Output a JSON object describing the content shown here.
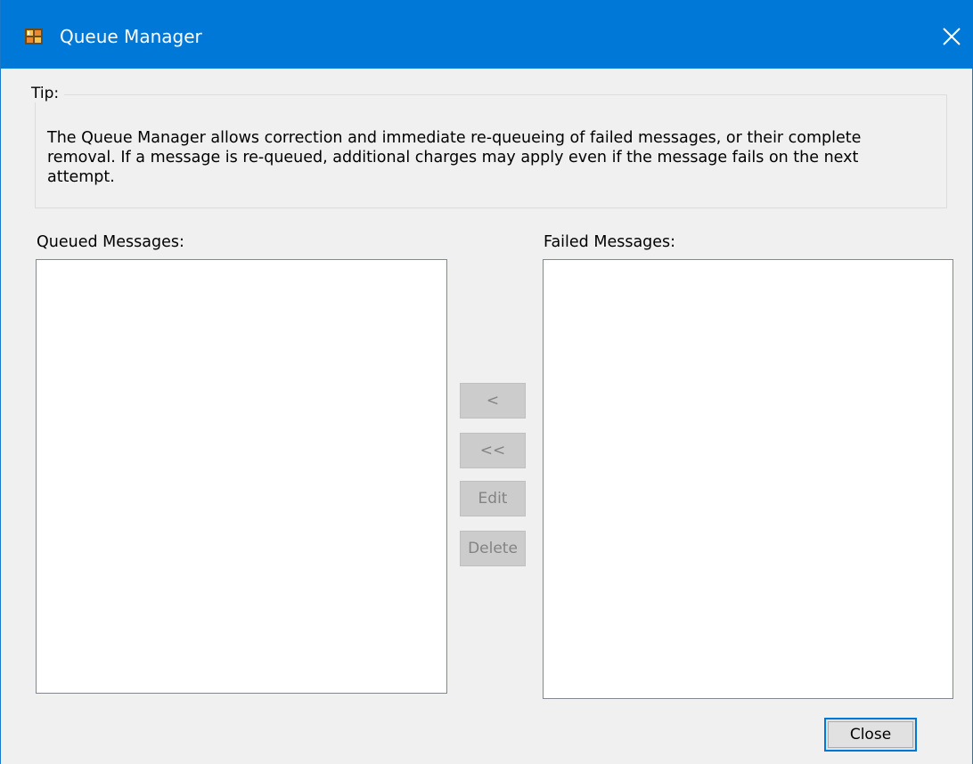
{
  "window": {
    "title": "Queue Manager",
    "accent": "#0078d7",
    "app_icon": "queue-manager-app-icon",
    "close_icon": "close-icon"
  },
  "tip": {
    "label": "Tip:",
    "text": "The Queue Manager allows correction and immediate re-queueing of failed messages, or their complete removal.  If a message is re-queued, additional charges may apply even if the message fails on the next attempt."
  },
  "queued": {
    "label": "Queued Messages:",
    "items": []
  },
  "failed": {
    "label": "Failed Messages:",
    "items": []
  },
  "actions": {
    "move_one": "<",
    "move_all": "<<",
    "edit": "Edit",
    "delete": "Delete"
  },
  "footer": {
    "close_label": "Close"
  }
}
